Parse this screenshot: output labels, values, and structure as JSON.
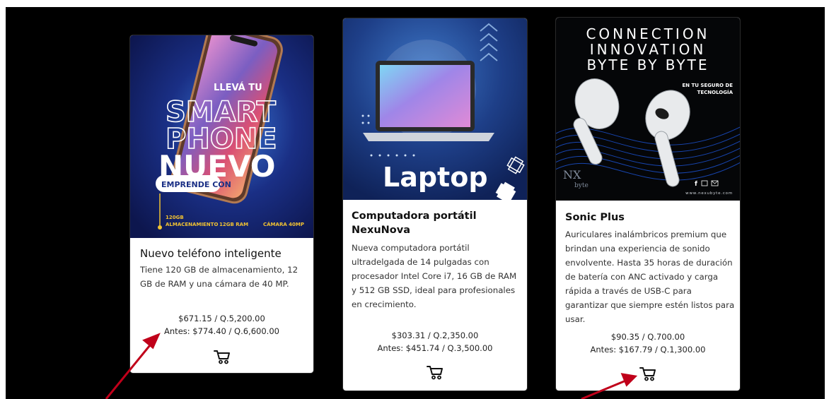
{
  "products": [
    {
      "image_text": {
        "kicker": "LLEVÁ TU",
        "word1": "SMART",
        "word2": "PHONE",
        "word3": "NUEVO",
        "pill": "EMPRENDE CON",
        "spec1": "120GB",
        "spec1b": "ALMACENAMIENTO",
        "spec2": "12GB RAM",
        "spec3": "CÁMARA 40MP"
      },
      "name": "Nuevo teléfono inteligente",
      "description": "Tiene 120 GB de almacenamiento, 12 GB de RAM y una cámara de 40 MP.",
      "price": "$671.15 / Q.5,200.00",
      "old_price": "Antes: $774.40 / Q.6,600.00",
      "icon": "cart-icon"
    },
    {
      "image_text": {
        "word1": "Laptop"
      },
      "name": "Computadora portátil NexuNova",
      "description": "Nueva computadora portátil ultradelgada de 14 pulgadas con procesador Intel Core i7, 16 GB de RAM y 512 GB SSD, ideal para profesionales en crecimiento.",
      "price": "$303.31 / Q.2,350.00",
      "old_price": "Antes: $451.74 / Q.3,500.00",
      "icon": "cart-icon"
    },
    {
      "image_text": {
        "line1": "CONNECTION",
        "line2": "INNOVATION",
        "line3": "BYTE BY BYTE",
        "tag1": "EN TU SEGURO DE",
        "tag2": "TECNOLOGÍA",
        "brand1": "NX",
        "brand2": "byte",
        "site": "www.nexubyte.com"
      },
      "name": "Sonic Plus",
      "description": "Auriculares inalámbricos premium que brindan una experiencia de sonido envolvente. Hasta 35 horas de duración de batería con ANC activado y carga rápida a través de USB-C para garantizar que siempre estén listos para usar.",
      "price": "$90.35 / Q.700.00",
      "old_price": "Antes: $167.79 / Q.1,300.00",
      "icon": "cart-icon"
    }
  ],
  "annotation": {
    "arrow_color": "#c0001a"
  }
}
